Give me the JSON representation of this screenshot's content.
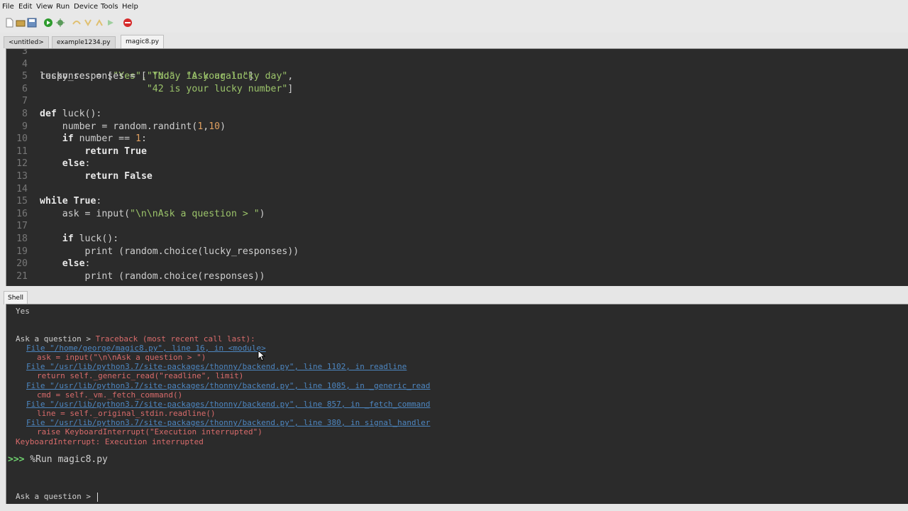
{
  "menu": [
    "File",
    "Edit",
    "View",
    "Run",
    "Device",
    "Tools",
    "Help"
  ],
  "tabs": [
    "<untitled>",
    "example1234.py",
    "magic8.py"
  ],
  "active_tab": "magic8.py",
  "editor": {
    "partial_line": "responses = [\"Yes\", \"No\", \"Ask again\"]",
    "lines": [
      {
        "n": "4",
        "text": ""
      },
      {
        "n": "5",
        "text": "lucky_responses = [\"Today is your lucky day\","
      },
      {
        "n": "6",
        "text": "                   \"42 is your lucky number\"]"
      },
      {
        "n": "7",
        "text": ""
      },
      {
        "n": "8",
        "text": "def luck():"
      },
      {
        "n": "9",
        "text": "    number = random.randint(1,10)"
      },
      {
        "n": "10",
        "text": "    if number == 1:"
      },
      {
        "n": "11",
        "text": "        return True"
      },
      {
        "n": "12",
        "text": "    else:"
      },
      {
        "n": "13",
        "text": "        return False"
      },
      {
        "n": "14",
        "text": ""
      },
      {
        "n": "15",
        "text": "while True:"
      },
      {
        "n": "16",
        "text": "    ask = input(\"\\n\\nAsk a question > \")"
      },
      {
        "n": "17",
        "text": ""
      },
      {
        "n": "18",
        "text": "    if luck():"
      },
      {
        "n": "19",
        "text": "        print (random.choice(lucky_responses))"
      },
      {
        "n": "20",
        "text": "    else:"
      },
      {
        "n": "21",
        "text": "        print (random.choice(responses))"
      }
    ]
  },
  "shell": {
    "tab_label": "Shell",
    "yes": "Yes",
    "ask_prompt": "Ask a question > ",
    "traceback_head": "Traceback (most recent call last):",
    "frames": [
      {
        "file": "File \"/home/george/magic8.py\", line 16, in <module>",
        "code": "ask = input(\"\\n\\nAsk a question > \")"
      },
      {
        "file": "File \"/usr/lib/python3.7/site-packages/thonny/backend.py\", line 1102, in readline",
        "code": "return self._generic_read(\"readline\", limit)"
      },
      {
        "file": "File \"/usr/lib/python3.7/site-packages/thonny/backend.py\", line 1085, in _generic_read",
        "code": "cmd = self._vm._fetch_command()"
      },
      {
        "file": "File \"/usr/lib/python3.7/site-packages/thonny/backend.py\", line 857, in _fetch_command",
        "code": "line = self._original_stdin.readline()"
      },
      {
        "file": "File \"/usr/lib/python3.7/site-packages/thonny/backend.py\", line 380, in signal_handler",
        "code": "raise KeyboardInterrupt(\"Execution interrupted\")"
      }
    ],
    "error_line": "KeyboardInterrupt: Execution interrupted",
    "prompt_symbol": ">>>",
    "run_command": "%Run magic8.py",
    "last_prompt": "Ask a question > "
  },
  "colors": {
    "editor_bg": "#2b2b2b",
    "string": "#9bc36a",
    "error": "#d86b6b",
    "link": "#4d86c0",
    "prompt": "#6fd06f"
  }
}
